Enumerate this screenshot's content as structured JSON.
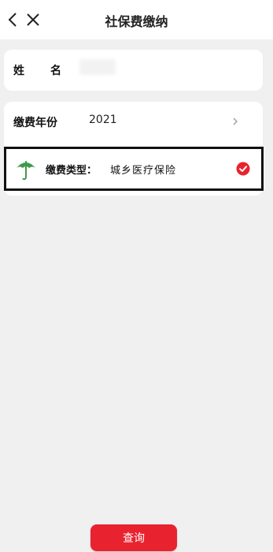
{
  "header": {
    "title": "社保费缴纳"
  },
  "name_card": {
    "label": "姓名",
    "value": ""
  },
  "payment_year": {
    "label": "缴费年份",
    "value": "2021"
  },
  "payment_type": {
    "label": "缴费类型：",
    "value": "城乡医疗保险"
  },
  "actions": {
    "query_label": "查询"
  },
  "colors": {
    "accent_red": "#e8232f",
    "umbrella_green": "#3f9a4a",
    "page_bg": "#f0f0f0"
  },
  "icons": {
    "back": "chevron-left-icon",
    "close": "close-icon",
    "year_arrow": "chevron-right-icon",
    "type": "umbrella-icon",
    "selected": "check-circle-icon"
  }
}
